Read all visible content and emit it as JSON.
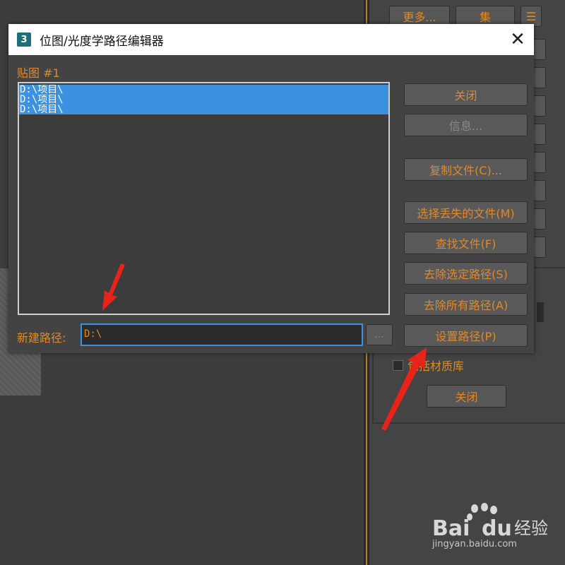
{
  "background": {
    "top_buttons": [
      "更多...",
      "集"
    ],
    "include_library": "包括材质库",
    "close": "关闭"
  },
  "dialog": {
    "title": "位图/光度学路径编辑器",
    "app_icon": "3",
    "map_label": "贴图 #1",
    "list_items": [
      "D:\\项目\\",
      "D:\\项目\\",
      "D:\\项目\\"
    ],
    "buttons": {
      "close": "关闭",
      "info": "信息...",
      "copy_files": "复制文件(C)...",
      "select_missing": "选择丢失的文件(M)",
      "find_files": "查找文件(F)",
      "strip_selected": "去除选定路径(S)",
      "strip_all": "去除所有路径(A)",
      "set_path": "设置路径(P)"
    },
    "new_path_label": "新建路径:",
    "new_path_value": "D:\\",
    "browse": "..."
  },
  "watermark": {
    "brand": "Bai",
    "brand_suffix": "经验",
    "url": "jingyan.baidu.com"
  },
  "colors": {
    "accent_text": "#e0892b",
    "selection": "#3c91e0",
    "annotation_arrow": "#e8231a"
  }
}
